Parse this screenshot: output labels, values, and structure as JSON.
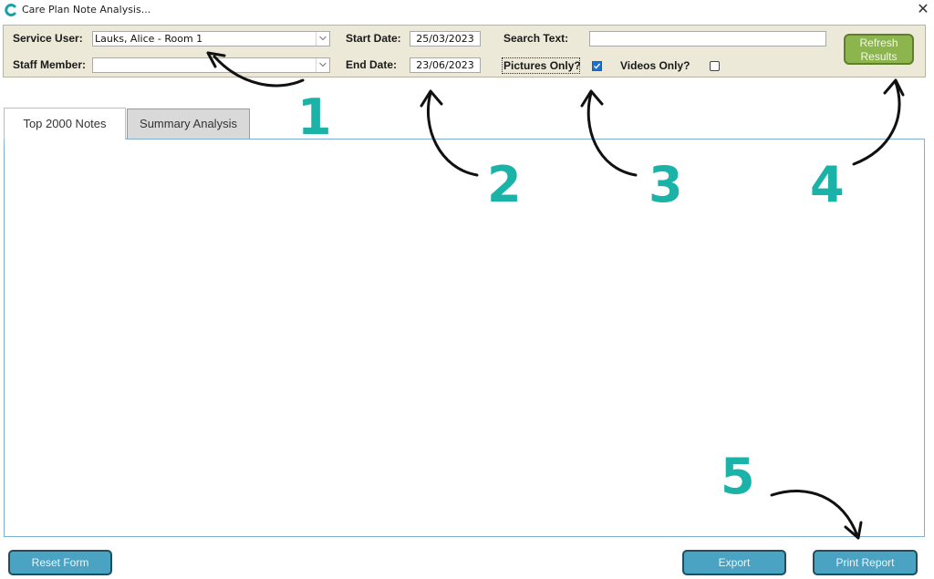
{
  "window": {
    "title": "Care Plan Note Analysis...",
    "close_glyph": "✕"
  },
  "filters": {
    "service_user_label": "Service User:",
    "service_user_value": "Lauks, Alice - Room 1",
    "staff_member_label": "Staff Member:",
    "staff_member_value": "",
    "start_date_label": "Start Date:",
    "start_date_value": "25/03/2023",
    "end_date_label": "End Date:",
    "end_date_value": "23/06/2023",
    "search_text_label": "Search Text:",
    "search_text_value": "",
    "pictures_only_label": "Pictures Only?",
    "pictures_only_checked": true,
    "videos_only_label": "Videos Only?",
    "videos_only_checked": false,
    "refresh_line1": "Refresh",
    "refresh_line2": "Results"
  },
  "tabs": [
    {
      "label": "Top 2000 Notes",
      "active": true
    },
    {
      "label": "Summary Analysis",
      "active": false
    }
  ],
  "buttons": {
    "reset": "Reset Form",
    "export": "Export",
    "print": "Print Report"
  },
  "annotations": [
    "1",
    "2",
    "3",
    "4",
    "5"
  ],
  "colors": {
    "accent_teal": "#1bb3a8",
    "refresh_green": "#8db54d",
    "button_blue": "#4aa3c2",
    "panel_beige": "#ece9d8"
  }
}
